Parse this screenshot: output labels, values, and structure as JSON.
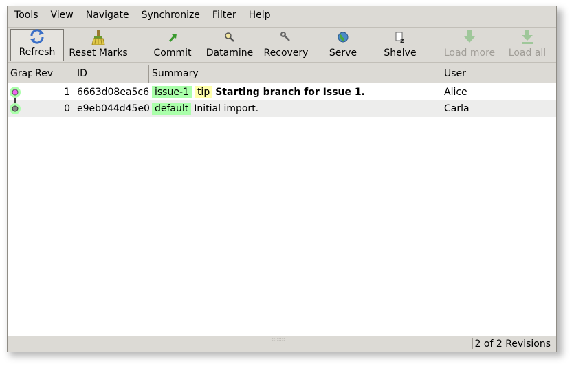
{
  "menubar": [
    {
      "mnemonic": "T",
      "rest": "ools"
    },
    {
      "mnemonic": "V",
      "rest": "iew"
    },
    {
      "mnemonic": "N",
      "rest": "avigate"
    },
    {
      "mnemonic": "S",
      "rest": "ynchronize"
    },
    {
      "mnemonic": "F",
      "rest": "ilter"
    },
    {
      "mnemonic": "H",
      "rest": "elp"
    }
  ],
  "toolbar": {
    "refresh": {
      "label": "Refresh",
      "icon": "refresh-icon"
    },
    "reset_marks": {
      "label": "Reset Marks",
      "icon": "broom-icon"
    },
    "commit": {
      "label": "Commit",
      "icon": "commit-arrow-icon"
    },
    "datamine": {
      "label": "Datamine",
      "icon": "magnifier-icon"
    },
    "recovery": {
      "label": "Recovery",
      "icon": "wrench-icon"
    },
    "serve": {
      "label": "Serve",
      "icon": "globe-icon"
    },
    "shelve": {
      "label": "Shelve",
      "icon": "shelve-icon"
    },
    "load_more": {
      "label": "Load more",
      "icon": "down-arrow-icon",
      "enabled": false
    },
    "load_all": {
      "label": "Load all",
      "icon": "down-arrow-bar-icon",
      "enabled": false
    }
  },
  "table": {
    "columns": {
      "graph": "Graph",
      "rev": "Rev",
      "id": "ID",
      "summary": "Summary",
      "user": "User"
    },
    "rows": [
      {
        "graph_color": "#ee66ee",
        "rev": "1",
        "id": "6663d08ea5c6",
        "branch": "issue-1",
        "tag": "tip",
        "summary": "Starting branch for Issue 1.",
        "user": "Alice"
      },
      {
        "graph_color": "#888888",
        "rev": "0",
        "id": "e9eb044d45e0",
        "branch": "default",
        "tag": "",
        "summary": "Initial import.",
        "user": "Carla"
      }
    ]
  },
  "status": {
    "revisions": "2 of 2 Revisions"
  },
  "colors": {
    "branch_tag_bg": "#aaffaa",
    "tip_tag_bg": "#ffffaa",
    "graph_node_halo": "#aaffaa"
  }
}
